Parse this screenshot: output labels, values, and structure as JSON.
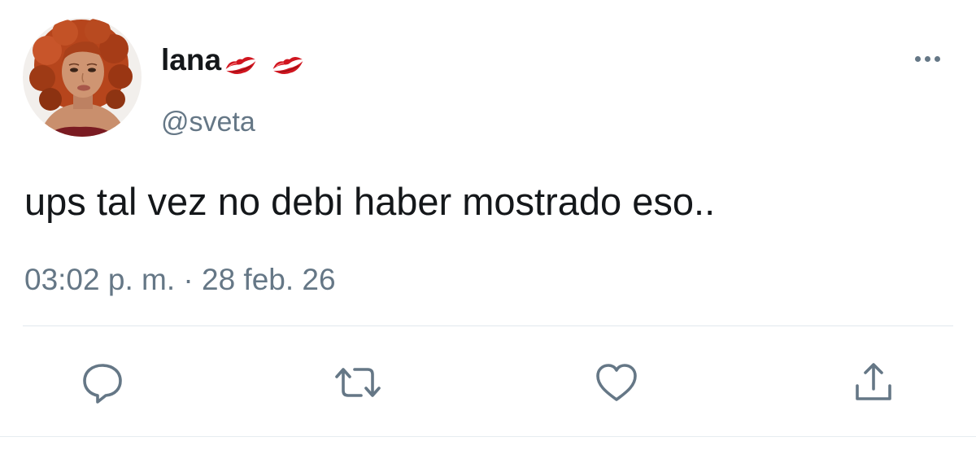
{
  "tweet": {
    "display_name": "lana",
    "name_emojis": [
      "kiss-mark-icon",
      "kiss-mark-icon"
    ],
    "handle": "@sveta",
    "text": "ups tal vez no debi haber mostrado eso..",
    "timestamp": "03:02 p. m. · 28 feb. 26"
  },
  "actions": [
    "reply-icon",
    "retweet-icon",
    "like-heart-icon",
    "share-icon"
  ],
  "colors": {
    "text": "#14171a",
    "secondary_text": "#657786",
    "divider": "#e1e8ed",
    "icon": "#657786",
    "kiss_red": "#d0151f"
  }
}
